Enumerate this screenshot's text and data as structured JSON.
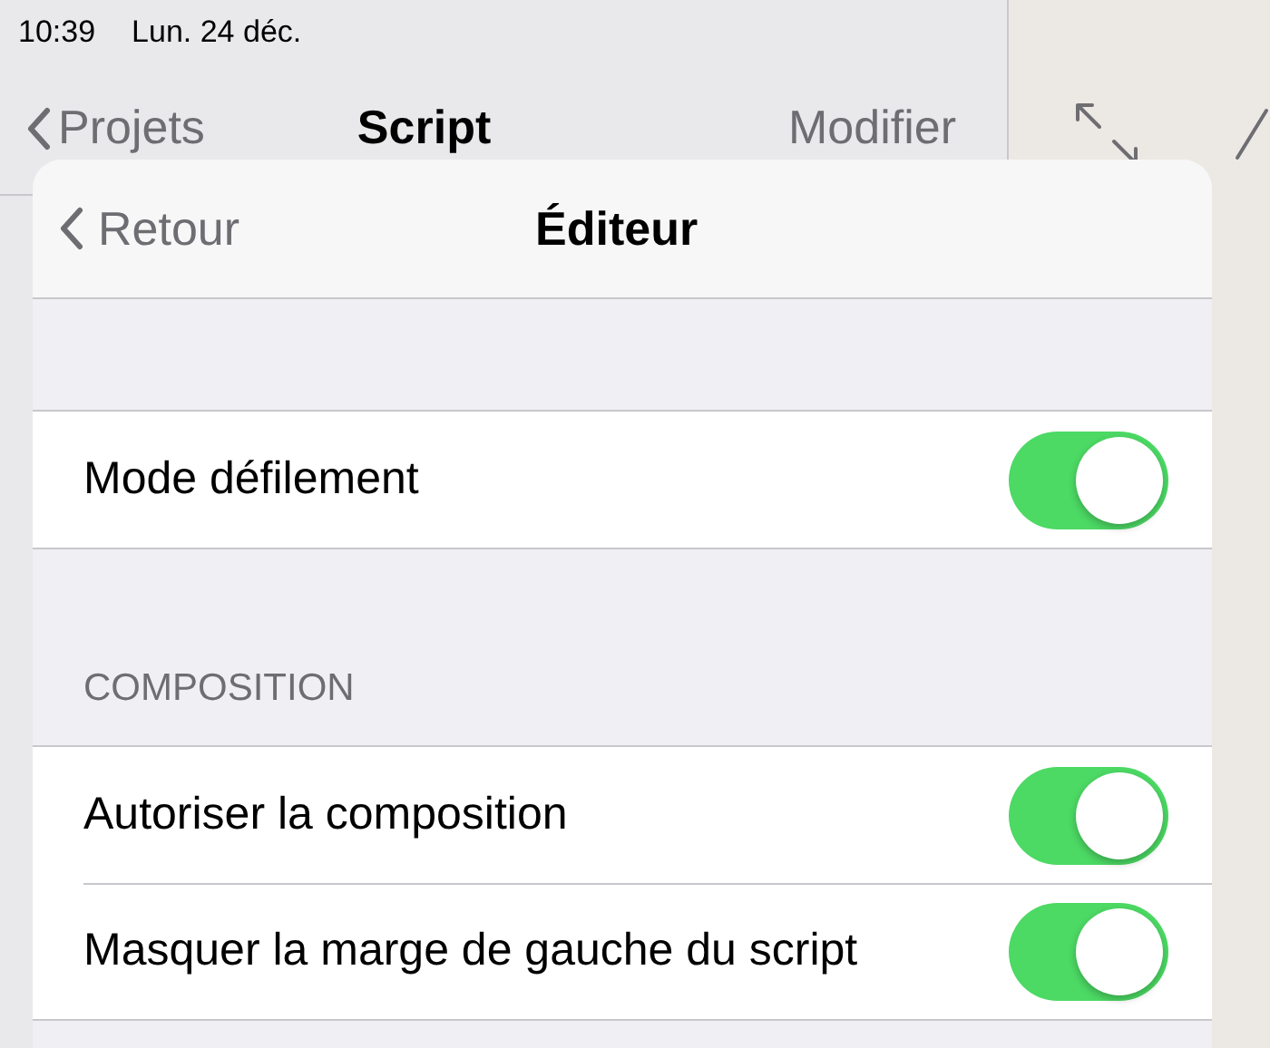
{
  "status_bar": {
    "time": "10:39",
    "date": "Lun. 24 déc."
  },
  "nav_bar": {
    "back": "Projets",
    "title": "Script",
    "action": "Modifier"
  },
  "popover": {
    "back": "Retour",
    "title": "Éditeur",
    "sections": [
      {
        "rows": [
          {
            "label": "Mode défilement",
            "on": true
          }
        ]
      },
      {
        "header": "COMPOSITION",
        "rows": [
          {
            "label": "Autoriser la composition",
            "on": true
          },
          {
            "label": "Masquer la marge de gauche du script",
            "on": true
          }
        ]
      }
    ]
  }
}
